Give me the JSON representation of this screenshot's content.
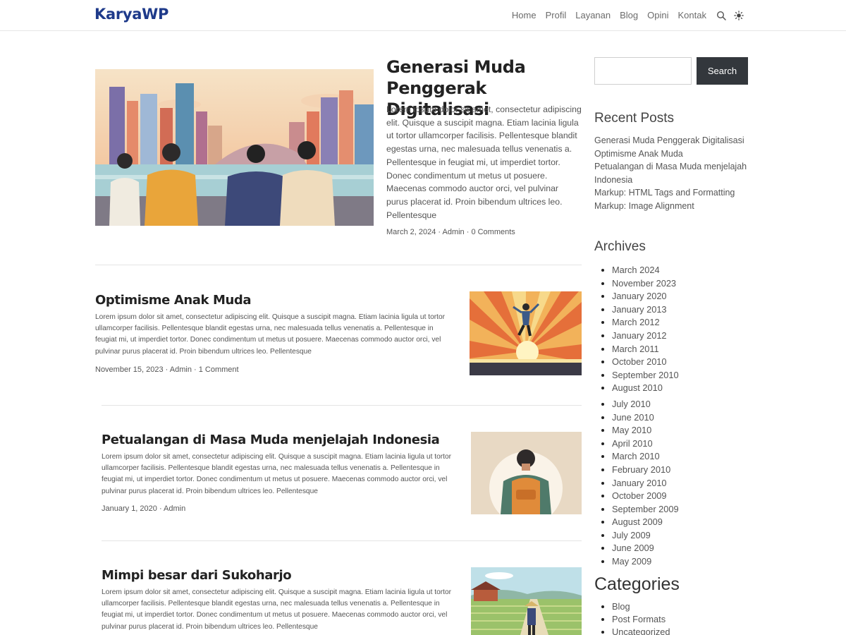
{
  "site": {
    "logo": "KaryaWP"
  },
  "nav": {
    "items": [
      "Home",
      "Profil",
      "Layanan",
      "Blog",
      "Opini",
      "Kontak"
    ]
  },
  "icons": {
    "search": "search-icon",
    "theme": "sun-icon"
  },
  "featured": {
    "title": "Generasi Muda Penggerak Digitalisasi",
    "excerpt": "Lorem ipsum dolor sit amet, consectetur adipiscing elit. Quisque a suscipit magna. Etiam lacinia ligula ut tortor ullamcorper facilisis. Pellentesque blandit egestas urna, nec malesuada tellus venenatis a. Pellentesque in feugiat mi, ut imperdiet tortor. Donec condimentum ut metus ut posuere. Maecenas commodo auctor orci, vel pulvinar purus placerat id. Proin bibendum ultrices leo. Pellentesque",
    "meta": "March 2, 2024 · Admin · 0 Comments"
  },
  "posts": [
    {
      "title": "Optimisme Anak Muda",
      "excerpt": "Lorem ipsum dolor sit amet, consectetur adipiscing elit. Quisque a suscipit magna. Etiam lacinia ligula ut tortor ullamcorper facilisis. Pellentesque blandit egestas urna, nec malesuada tellus venenatis a. Pellentesque in feugiat mi, ut imperdiet tortor. Donec condimentum ut metus ut posuere. Maecenas commodo auctor orci, vel pulvinar purus placerat id. Proin bibendum ultrices leo. Pellentesque",
      "meta": "November 15, 2023 · Admin · 1 Comment"
    },
    {
      "title": "Petualangan di Masa Muda menjelajah Indonesia",
      "excerpt": "Lorem ipsum dolor sit amet, consectetur adipiscing elit. Quisque a suscipit magna. Etiam lacinia ligula ut tortor ullamcorper facilisis. Pellentesque blandit egestas urna, nec malesuada tellus venenatis a. Pellentesque in feugiat mi, ut imperdiet tortor. Donec condimentum ut metus ut posuere. Maecenas commodo auctor orci, vel pulvinar purus placerat id. Proin bibendum ultrices leo. Pellentesque",
      "meta": "January 1, 2020 · Admin"
    },
    {
      "title": "Mimpi besar dari Sukoharjo",
      "excerpt": "Lorem ipsum dolor sit amet, consectetur adipiscing elit. Quisque a suscipit magna. Etiam lacinia ligula ut tortor ullamcorper facilisis. Pellentesque blandit egestas urna, nec malesuada tellus venenatis a. Pellentesque in feugiat mi, ut imperdiet tortor. Donec condimentum ut metus ut posuere. Maecenas commodo auctor orci, vel pulvinar purus placerat id. Proin bibendum ultrices leo. Pellentesque"
    }
  ],
  "sidebar": {
    "search_button": "Search",
    "search_placeholder": "",
    "recent_title": "Recent Posts",
    "recent": [
      "Generasi Muda Penggerak Digitalisasi",
      "Optimisme Anak Muda",
      "Petualangan di Masa Muda menjelajah Indonesia",
      "Markup: HTML Tags and Formatting",
      "Markup: Image Alignment"
    ],
    "archives_title": "Archives",
    "archives": [
      "March 2024",
      "November 2023",
      "January 2020",
      "January 2013",
      "March 2012",
      "January 2012",
      "March 2011",
      "October 2010",
      "September 2010",
      "August 2010",
      "July 2010",
      "June 2010",
      "May 2010",
      "April 2010",
      "March 2010",
      "February 2010",
      "January 2010",
      "October 2009",
      "September 2009",
      "August 2009",
      "July 2009",
      "June 2009",
      "May 2009"
    ],
    "categories_title": "Categories",
    "categories": [
      "Blog",
      "Post Formats",
      "Uncategorized"
    ]
  }
}
